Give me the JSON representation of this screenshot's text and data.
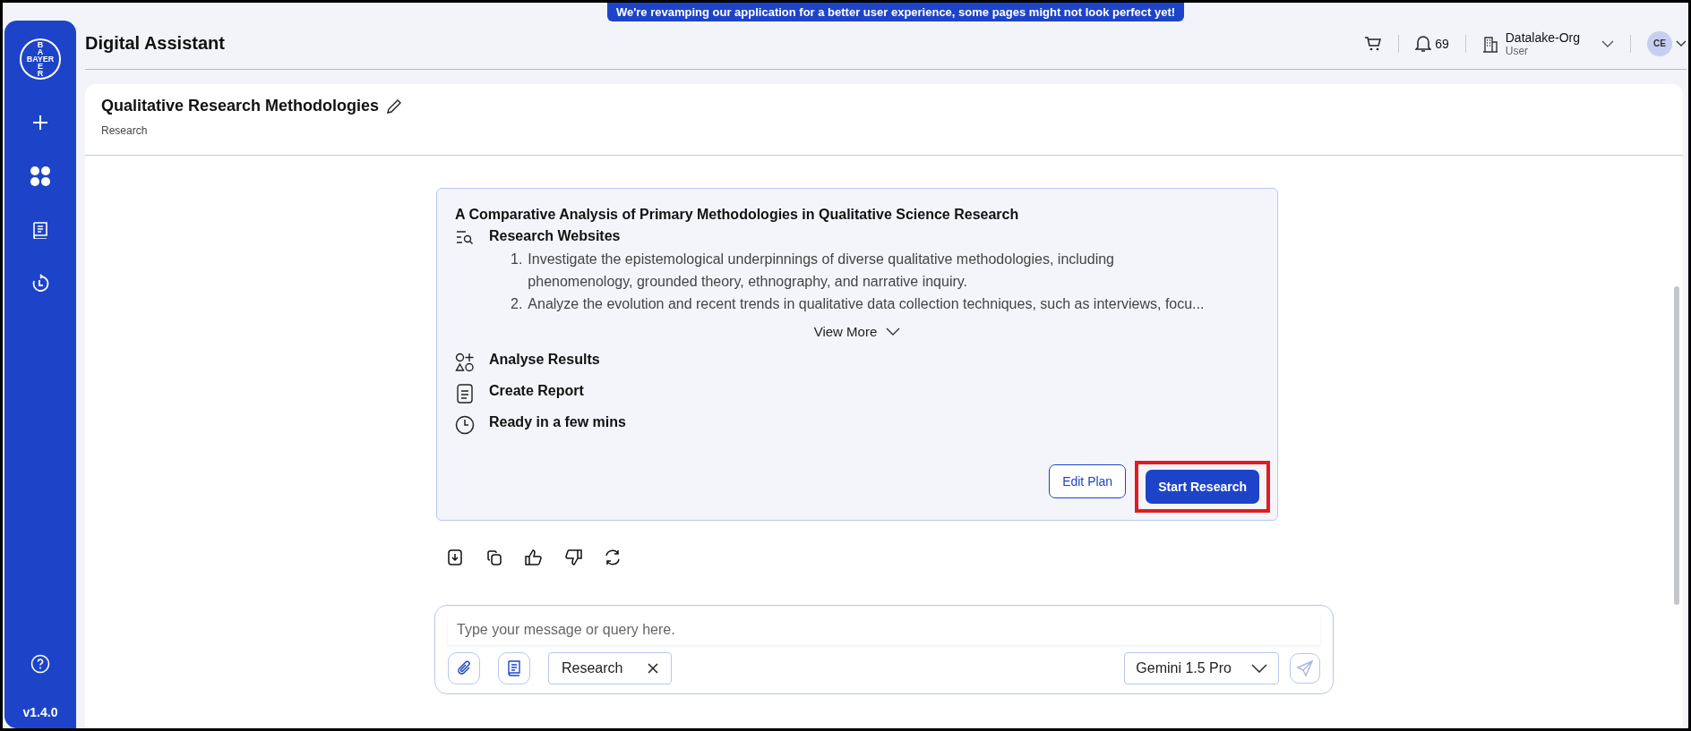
{
  "banner": "We're revamping our application for a better user experience, some pages might not look perfect yet!",
  "sidebar": {
    "logo_lines": [
      "B",
      "A",
      "BAYER",
      "E",
      "R"
    ],
    "version": "v1.4.0"
  },
  "header": {
    "title": "Digital Assistant",
    "notifications": "69",
    "org": "Datalake-Org",
    "role": "User",
    "avatar": "CE"
  },
  "chat": {
    "title": "Qualitative Research Methodologies",
    "subtitle": "Research"
  },
  "plan": {
    "title": "A Comparative Analysis of Primary Methodologies in Qualitative Science Research",
    "steps": [
      {
        "kind": "websites",
        "label": "Research Websites",
        "items": [
          {
            "number": "1.",
            "text": "Investigate the epistemological underpinnings of diverse qualitative methodologies, including phenomenology, grounded theory, ethnography, and narrative inquiry."
          },
          {
            "number": "2.",
            "text": "Analyze the evolution and recent trends in qualitative data collection techniques, such as interviews, focu..."
          }
        ]
      },
      {
        "kind": "analyse",
        "label": "Analyse Results"
      },
      {
        "kind": "report",
        "label": "Create Report"
      },
      {
        "kind": "time",
        "label": "Ready in a few mins"
      }
    ],
    "view_more": "View More",
    "buttons": [
      {
        "label": "Edit Plan",
        "kind": "outline",
        "highlighted": false
      },
      {
        "label": "Start Research",
        "kind": "primary",
        "highlighted": true
      }
    ]
  },
  "composer": {
    "placeholder": "Type your message or query here.",
    "tag": "Research",
    "model": "Gemini 1.5 Pro"
  }
}
